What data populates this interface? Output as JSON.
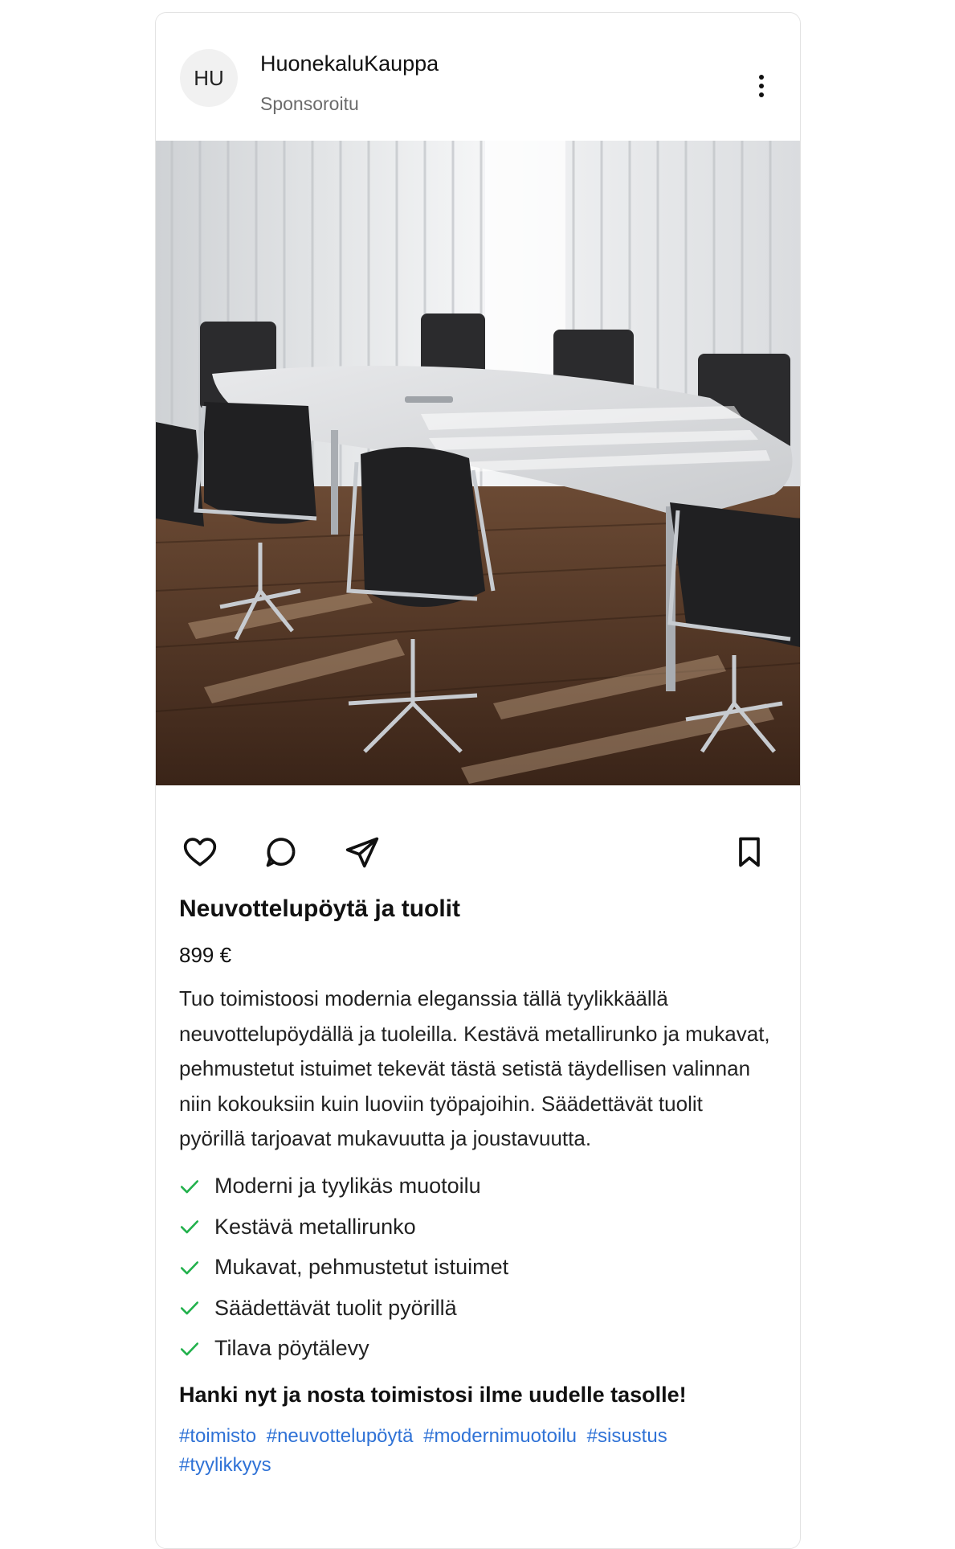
{
  "post": {
    "avatar_initials": "HU",
    "username": "HuonekaluKauppa",
    "sponsored_label": "Sponsoroitu"
  },
  "product": {
    "title": "Neuvottelupöytä ja tuolit",
    "price": "899 €",
    "description": "Tuo toimistoosi modernia eleganssia tällä tyylikkäällä neuvottelupöydällä ja tuoleilla. Kestävä metallirunko ja mukavat, pehmustetut istuimet tekevät tästä setistä täydellisen valinnan niin kokouksiin kuin luoviin työpajoihin. Säädettävät tuolit pyörillä tarjoavat mukavuutta ja joustavuutta.",
    "features": [
      "Moderni ja tyylikäs muotoilu",
      "Kestävä metallirunko",
      "Mukavat, pehmustetut istuimet",
      "Säädettävät tuolit pyörillä",
      "Tilava pöytälevy"
    ],
    "cta": "Hanki nyt ja nosta toimistosi ilme uudelle tasolle!",
    "hashtags": [
      "#toimisto",
      "#neuvottelupöytä",
      "#modernimuotoilu",
      "#sisustus",
      "#tyylikkyys"
    ]
  },
  "icons": {
    "like": "heart-icon",
    "comment": "comment-icon",
    "share": "send-icon",
    "save": "bookmark-icon",
    "more": "more-vertical-icon",
    "feature_check": "check-icon"
  },
  "colors": {
    "check": "#22b14c",
    "hashtag": "#2f72d6",
    "muted": "#6b6b6b"
  }
}
